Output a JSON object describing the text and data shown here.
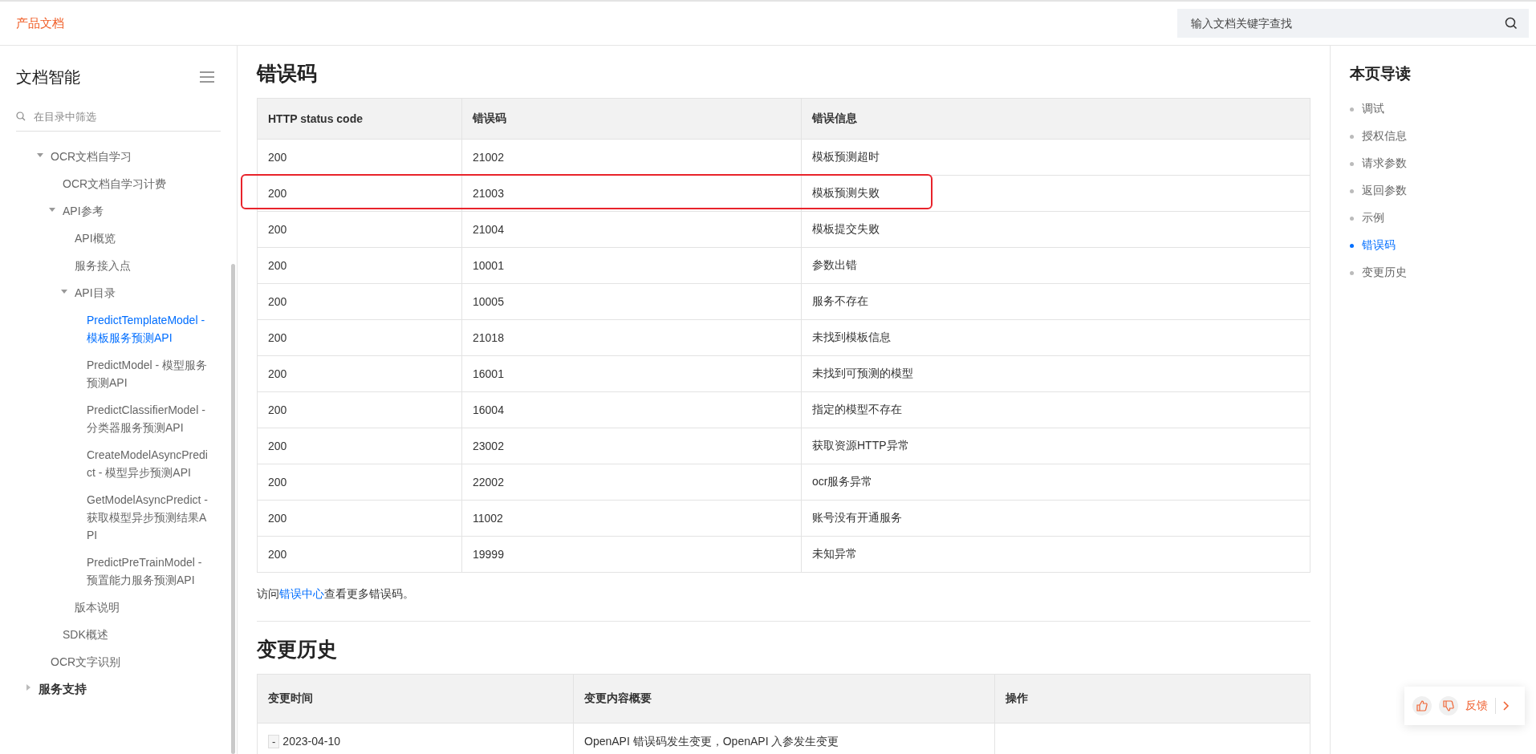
{
  "top_bar": {
    "brand": "产品文档",
    "search": {
      "placeholder": "输入文档关键字查找"
    }
  },
  "sidebar": {
    "title": "文档智能",
    "filter": {
      "placeholder": "在目录中筛选"
    },
    "items": [
      {
        "label": "OCR文档自学习",
        "selected": false,
        "expanded": true,
        "children": [
          {
            "label": "OCR文档自学习计费",
            "selected": false
          },
          {
            "label": "API参考",
            "selected": false,
            "expanded": true,
            "children": [
              {
                "label": "API概览",
                "selected": false
              },
              {
                "label": "服务接入点",
                "selected": false
              },
              {
                "label": "API目录",
                "selected": false,
                "expanded": true,
                "children": [
                  {
                    "label": "PredictTemplateModel - 模板服务预测API",
                    "selected": true
                  },
                  {
                    "label": "PredictModel - 模型服务预测API",
                    "selected": false
                  },
                  {
                    "label": "PredictClassifierModel - 分类器服务预测API",
                    "selected": false
                  },
                  {
                    "label": "CreateModelAsyncPredict - 模型异步预测API",
                    "selected": false
                  },
                  {
                    "label": "GetModelAsyncPredict - 获取模型异步预测结果API",
                    "selected": false
                  },
                  {
                    "label": "PredictPreTrainModel - 预置能力服务预测API",
                    "selected": false
                  }
                ]
              },
              {
                "label": "版本说明",
                "selected": false
              }
            ]
          },
          {
            "label": "SDK概述",
            "selected": false
          }
        ]
      },
      {
        "label": "OCR文字识别",
        "selected": false
      }
    ],
    "sections": [
      {
        "label": "服务支持",
        "expanded": false
      }
    ]
  },
  "error_section": {
    "heading": "错误码",
    "columns": [
      "HTTP status code",
      "错误码",
      "错误信息"
    ],
    "rows": [
      {
        "cells": [
          "200",
          "21002",
          "模板预测超时"
        ],
        "highlighted": false
      },
      {
        "cells": [
          "200",
          "21003",
          "模板预测失败"
        ],
        "highlighted": true
      },
      {
        "cells": [
          "200",
          "21004",
          "模板提交失败"
        ],
        "highlighted": false
      },
      {
        "cells": [
          "200",
          "10001",
          "参数出错"
        ],
        "highlighted": false
      },
      {
        "cells": [
          "200",
          "10005",
          "服务不存在"
        ],
        "highlighted": false
      },
      {
        "cells": [
          "200",
          "21018",
          "未找到模板信息"
        ],
        "highlighted": false
      },
      {
        "cells": [
          "200",
          "16001",
          "未找到可预测的模型"
        ],
        "highlighted": false
      },
      {
        "cells": [
          "200",
          "16004",
          "指定的模型不存在"
        ],
        "highlighted": false
      },
      {
        "cells": [
          "200",
          "23002",
          "获取资源HTTP异常"
        ],
        "highlighted": false
      },
      {
        "cells": [
          "200",
          "22002",
          "ocr服务异常"
        ],
        "highlighted": false
      },
      {
        "cells": [
          "200",
          "11002",
          "账号没有开通服务"
        ],
        "highlighted": false
      },
      {
        "cells": [
          "200",
          "19999",
          "未知异常"
        ],
        "highlighted": false
      }
    ],
    "note": {
      "before": "访问",
      "link": "错误中心",
      "after": "查看更多错误码。"
    }
  },
  "history_section": {
    "heading": "变更历史",
    "columns": [
      "变更时间",
      "变更内容概要",
      "操作"
    ],
    "rows": [
      {
        "toggle": "-",
        "date": "2023-04-10",
        "summary": "OpenAPI 错误码发生变更，OpenAPI 入参发生变更"
      }
    ]
  },
  "page_nav": {
    "title": "本页导读",
    "items": [
      {
        "label": "调试",
        "selected": false
      },
      {
        "label": "授权信息",
        "selected": false
      },
      {
        "label": "请求参数",
        "selected": false
      },
      {
        "label": "返回参数",
        "selected": false
      },
      {
        "label": "示例",
        "selected": false
      },
      {
        "label": "错误码",
        "selected": true
      },
      {
        "label": "变更历史",
        "selected": false
      }
    ]
  },
  "feedback": {
    "label": "反馈"
  }
}
